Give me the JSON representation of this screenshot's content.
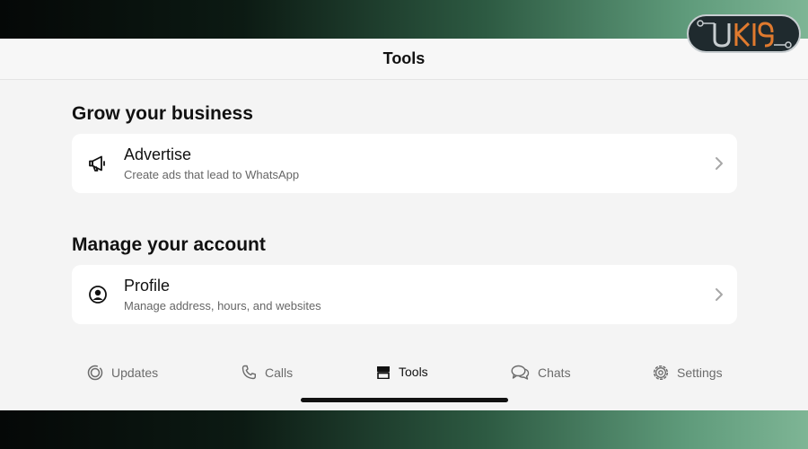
{
  "header": {
    "title": "Tools"
  },
  "sections": [
    {
      "title": "Grow your business",
      "item": {
        "title": "Advertise",
        "subtitle": "Create ads that lead to WhatsApp",
        "icon": "megaphone-icon"
      }
    },
    {
      "title": "Manage your account",
      "item": {
        "title": "Profile",
        "subtitle": "Manage address, hours, and websites",
        "icon": "profile-icon"
      }
    }
  ],
  "tabs": [
    {
      "label": "Updates",
      "icon": "updates-icon"
    },
    {
      "label": "Calls",
      "icon": "phone-icon"
    },
    {
      "label": "Tools",
      "icon": "store-icon",
      "active": true
    },
    {
      "label": "Chats",
      "icon": "chat-bubbles-icon"
    },
    {
      "label": "Settings",
      "icon": "gear-icon"
    }
  ],
  "colors": {
    "screen_bg": "#f4f4f4",
    "card_bg": "#ffffff",
    "text": "#111111",
    "muted": "#6b6b6b"
  }
}
